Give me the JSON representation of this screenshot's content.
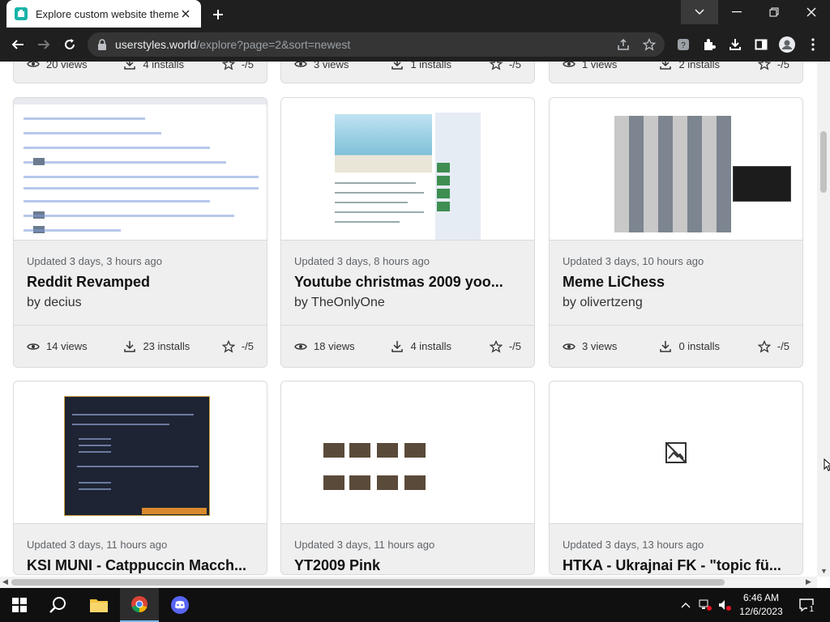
{
  "browser": {
    "tab_title": "Explore custom website themes",
    "url_host": "userstyles.world",
    "url_path": "/explore?page=2&sort=newest"
  },
  "top_row": [
    {
      "views": "20 views",
      "installs": "4 installs",
      "rating": "-/5"
    },
    {
      "views": "3 views",
      "installs": "1 installs",
      "rating": "-/5"
    },
    {
      "views": "1 views",
      "installs": "2 installs",
      "rating": "-/5"
    }
  ],
  "cards": [
    {
      "updated": "Updated 3 days, 3 hours ago",
      "name": "Reddit Revamped",
      "author": "by decius",
      "views": "14 views",
      "installs": "23 installs",
      "rating": "-/5"
    },
    {
      "updated": "Updated 3 days, 8 hours ago",
      "name": "Youtube christmas 2009 yoo...",
      "author": "by TheOnlyOne",
      "views": "18 views",
      "installs": "4 installs",
      "rating": "-/5"
    },
    {
      "updated": "Updated 3 days, 10 hours ago",
      "name": "Meme LiChess",
      "author": "by olivertzeng",
      "views": "3 views",
      "installs": "0 installs",
      "rating": "-/5"
    },
    {
      "updated": "Updated 3 days, 11 hours ago",
      "name": "KSI MUNI - Catppuccin Macch...",
      "author": "",
      "views": "",
      "installs": "",
      "rating": ""
    },
    {
      "updated": "Updated 3 days, 11 hours ago",
      "name": "YT2009 Pink",
      "author": "",
      "views": "",
      "installs": "",
      "rating": ""
    },
    {
      "updated": "Updated 3 days, 13 hours ago",
      "name": "HTKA - Ukrajnai FK - \"topic fü...",
      "author": "",
      "views": "",
      "installs": "",
      "rating": ""
    }
  ],
  "taskbar": {
    "time": "6:46 AM",
    "date": "12/6/2023",
    "notification_count": "1"
  },
  "icons": [
    "favicon-icon",
    "close-icon",
    "plus-icon",
    "chevron-down-icon",
    "minimize-icon",
    "maximize-icon",
    "back-icon",
    "forward-icon",
    "reload-icon",
    "lock-icon",
    "share-icon",
    "star-icon",
    "extension-icon",
    "puzzle-icon",
    "download-icon",
    "sidebar-icon",
    "profile-icon",
    "menu-icon",
    "eye-icon",
    "install-icon",
    "no-image-icon",
    "windows-icon",
    "search-icon",
    "file-explorer-icon",
    "chrome-icon",
    "discord-icon"
  ]
}
